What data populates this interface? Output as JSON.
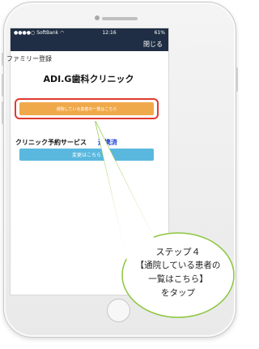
{
  "status_bar": {
    "carrier": "SoftBank",
    "time": "12:16",
    "battery": "61%"
  },
  "nav": {
    "close_label": "閉じる"
  },
  "screen": {
    "title": "ファミリー登録",
    "clinic_name": "ADI.G歯科クリニック",
    "list_button_label": "通院している患者の一覧はこちら",
    "service_label": "クリニック予約サービス",
    "service_status": "連携済",
    "change_button_label": "変更はこちら"
  },
  "callout": {
    "step": "ステップ４",
    "line1": "【通院している患者の",
    "line2": "一覧はこちら】",
    "line3": "をタップ"
  },
  "colors": {
    "nav_bg": "#1f2e44",
    "list_button": "#f0a94a",
    "change_button": "#5ab8df",
    "highlight": "#e03a2f",
    "service_status": "#1a3fd6",
    "callout_border": "#8dc63f"
  }
}
